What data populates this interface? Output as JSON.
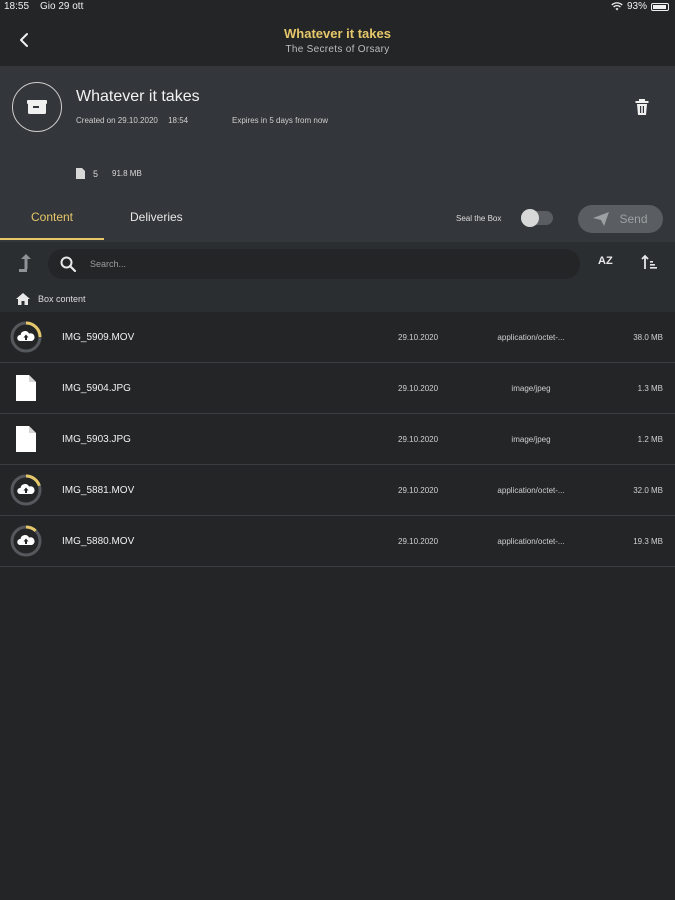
{
  "status_bar": {
    "time": "18:55",
    "date": "Gio 29 ott",
    "battery": "93%"
  },
  "header": {
    "title": "Whatever it takes",
    "subtitle": "The Secrets of Orsary"
  },
  "box": {
    "title": "Whatever it takes",
    "created": "Created on 29.10.2020",
    "created_time": "18:54",
    "expires": "Expires in 5 days from now",
    "file_count": "5",
    "total_size": "91.8 MB"
  },
  "tabs": [
    {
      "label": "Content",
      "active": true
    },
    {
      "label": "Deliveries",
      "active": false
    }
  ],
  "seal": {
    "label": "Seal the Box",
    "enabled": false
  },
  "send_label": "Send",
  "search": {
    "placeholder": "Search...",
    "value": ""
  },
  "sort_label": "AZ",
  "breadcrumb": "Box content",
  "files": [
    {
      "name": "IMG_5909.MOV",
      "date": "29.10.2020",
      "type": "application/octet-...",
      "size": "38.0 MB",
      "icon": "cloud-upload-progress-icon",
      "progress": 0.25
    },
    {
      "name": "IMG_5904.JPG",
      "date": "29.10.2020",
      "type": "image/jpeg",
      "size": "1.3 MB",
      "icon": "file-icon"
    },
    {
      "name": "IMG_5903.JPG",
      "date": "29.10.2020",
      "type": "image/jpeg",
      "size": "1.2 MB",
      "icon": "file-icon"
    },
    {
      "name": "IMG_5881.MOV",
      "date": "29.10.2020",
      "type": "application/octet-...",
      "size": "32.0 MB",
      "icon": "cloud-upload-progress-icon",
      "progress": 0.2
    },
    {
      "name": "IMG_5880.MOV",
      "date": "29.10.2020",
      "type": "application/octet-...",
      "size": "19.3 MB",
      "icon": "cloud-upload-progress-icon",
      "progress": 0.12
    }
  ],
  "colors": {
    "accent": "#e6c76a",
    "background": "#232527",
    "panel": "#33363a"
  }
}
